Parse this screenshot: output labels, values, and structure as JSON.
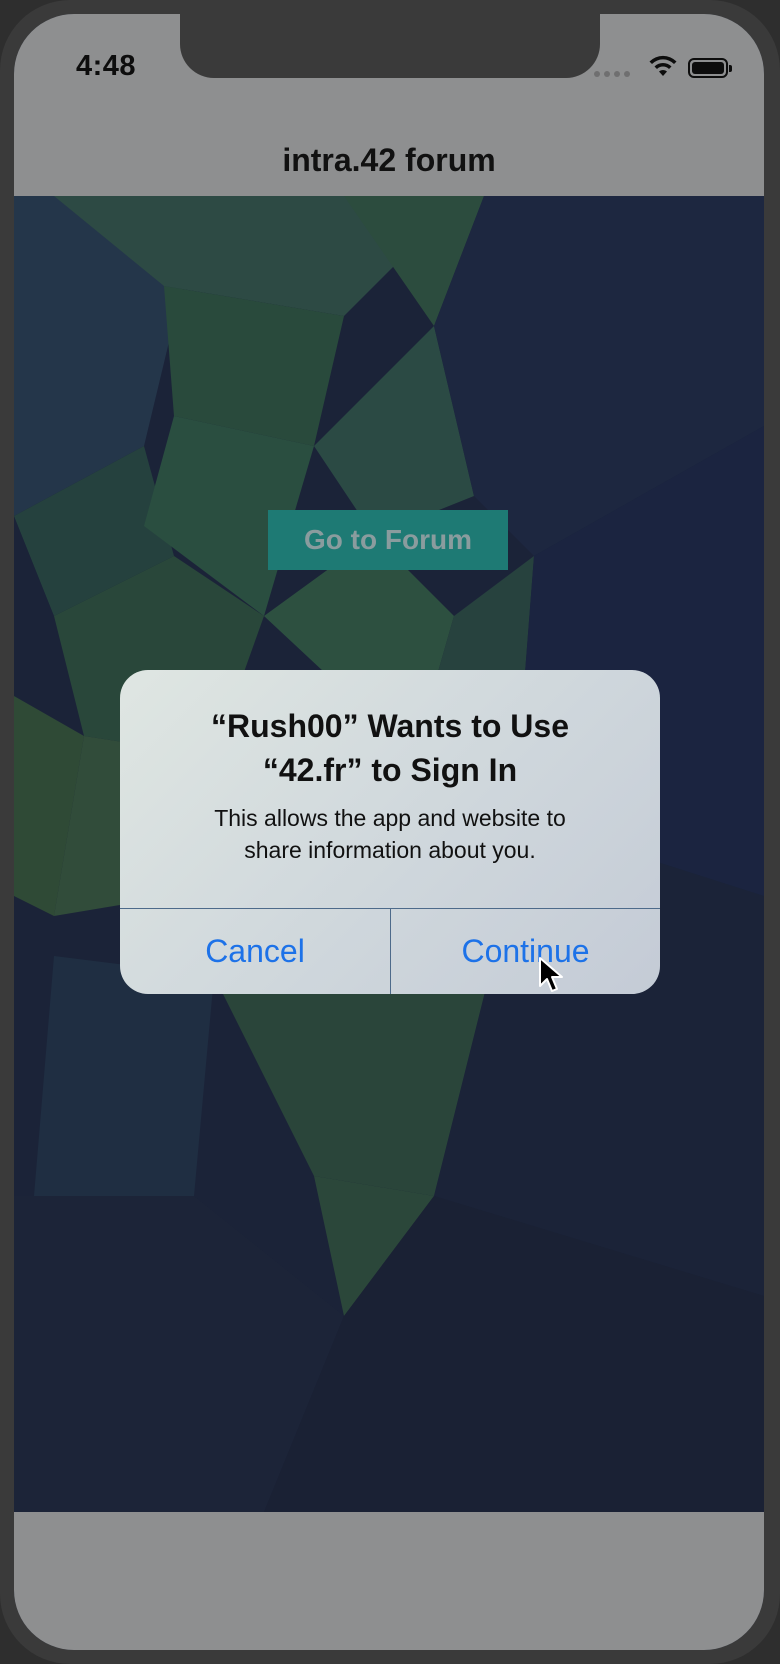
{
  "status_bar": {
    "time": "4:48",
    "wifi_icon": "wifi-icon",
    "battery_icon": "battery-icon"
  },
  "nav": {
    "title": "intra.42 forum"
  },
  "main": {
    "forum_button_label": "Go to Forum"
  },
  "alert": {
    "title_line1": "“Rush00” Wants to Use",
    "title_line2": "“42.fr” to Sign In",
    "message_line1": "This allows the app and website to",
    "message_line2": "share information about you.",
    "cancel_label": "Cancel",
    "continue_label": "Continue"
  },
  "colors": {
    "accent": "#1d72e8",
    "forum_button": "#1e7a74"
  }
}
